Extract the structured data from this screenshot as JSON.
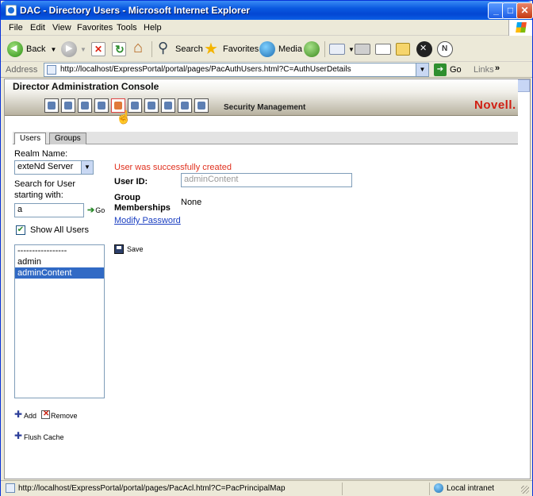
{
  "window": {
    "title": "DAC - Directory Users - Microsoft Internet Explorer"
  },
  "menu": [
    "File",
    "Edit",
    "View",
    "Favorites",
    "Tools",
    "Help"
  ],
  "toolbar": {
    "back_label": "Back",
    "search_label": "Search",
    "favorites_label": "Favorites",
    "media_label": "Media"
  },
  "address": {
    "label": "Address",
    "url": "http://localhost/ExpressPortal/portal/pages/PacAuthUsers.html?C=AuthUserDetails",
    "go_label": "Go",
    "links_label": "Links"
  },
  "dac": {
    "title": "Director Administration Console",
    "section": "Security Management",
    "brand": "Novell."
  },
  "tabs": {
    "users": "Users",
    "groups": "Groups"
  },
  "left": {
    "realm_label": "Realm Name:",
    "realm_value": "exteNd Server",
    "search_label_1": "Search for User",
    "search_label_2": "starting with:",
    "search_value": "a",
    "go_label": "Go",
    "show_all_label": "Show All Users",
    "show_all_checked": true,
    "users": [
      "-----------------",
      "admin",
      "adminContent"
    ],
    "selected_user": "adminContent",
    "add_label": "Add",
    "remove_label": "Remove",
    "flush_label": "Flush Cache"
  },
  "details": {
    "success_message": "User was successfully created",
    "userid_label": "User ID:",
    "userid_value": "adminContent",
    "group_label_1": "Group",
    "group_label_2": "Memberships",
    "group_value": "None",
    "modify_password": "Modify Password",
    "save_label": "Save"
  },
  "status": {
    "url": "http://localhost/ExpressPortal/portal/pages/PacAcl.html?C=PacPrincipalMap",
    "zone": "Local intranet"
  },
  "colors": {
    "titlebar": "#0a58e0",
    "success": "#e0301e",
    "link": "#1a3ec1",
    "brand": "#d01e12",
    "selection": "#316ac5"
  }
}
